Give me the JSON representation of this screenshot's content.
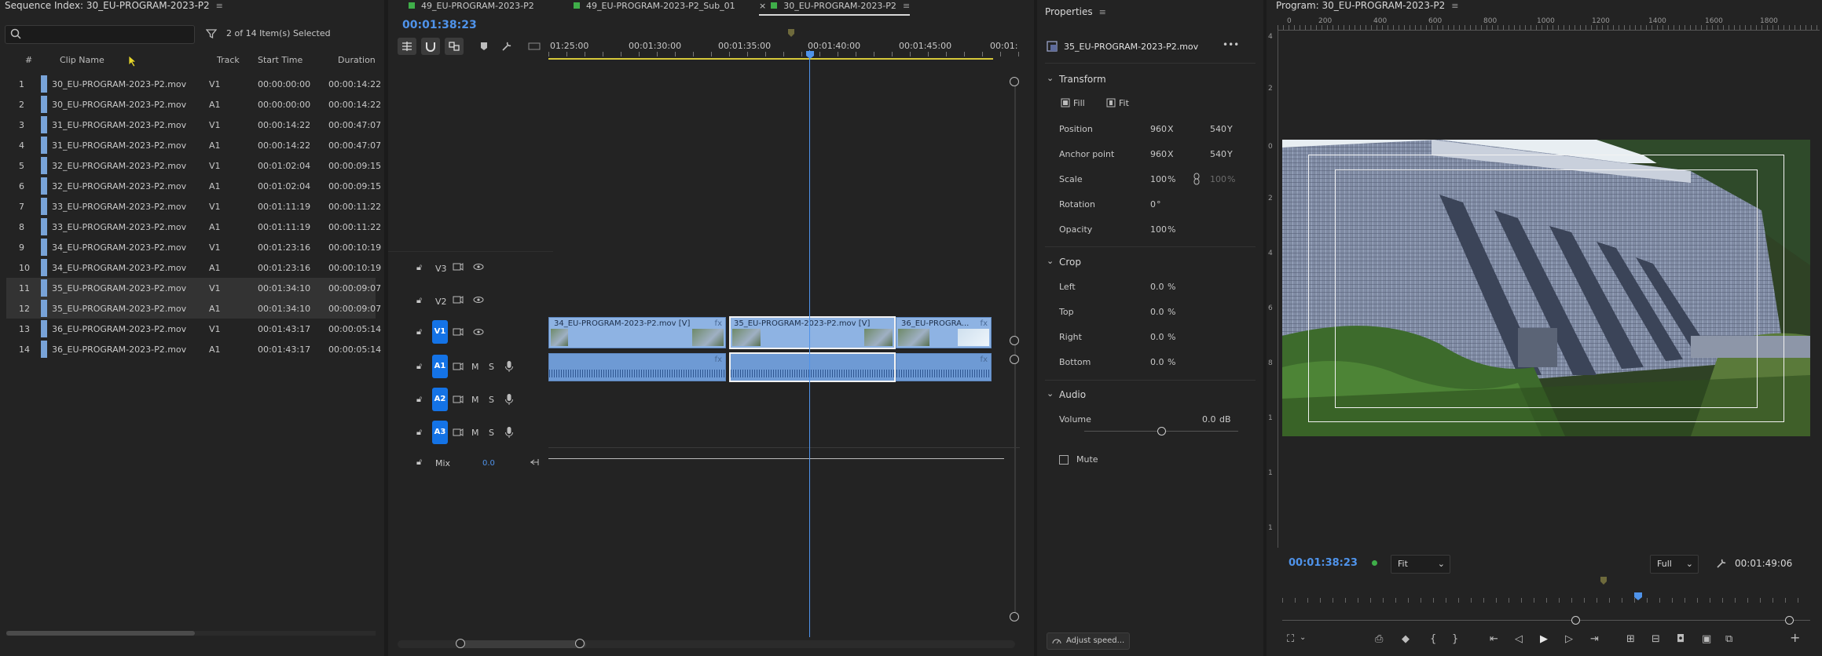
{
  "sequence_index": {
    "title": "Sequence Index: 30_EU-PROGRAM-2023-P2",
    "search_placeholder": "",
    "selection_status": "2 of 14 Item(s) Selected",
    "columns": [
      "#",
      "Clip Name",
      "Track",
      "Start Time",
      "Duration"
    ],
    "rows": [
      {
        "num": "1",
        "name": "30_EU-PROGRAM-2023-P2.mov",
        "track": "V1",
        "start": "00:00:00:00",
        "duration": "00:00:14:22"
      },
      {
        "num": "2",
        "name": "30_EU-PROGRAM-2023-P2.mov",
        "track": "A1",
        "start": "00:00:00:00",
        "duration": "00:00:14:22"
      },
      {
        "num": "3",
        "name": "31_EU-PROGRAM-2023-P2.mov",
        "track": "V1",
        "start": "00:00:14:22",
        "duration": "00:00:47:07"
      },
      {
        "num": "4",
        "name": "31_EU-PROGRAM-2023-P2.mov",
        "track": "A1",
        "start": "00:00:14:22",
        "duration": "00:00:47:07"
      },
      {
        "num": "5",
        "name": "32_EU-PROGRAM-2023-P2.mov",
        "track": "V1",
        "start": "00:01:02:04",
        "duration": "00:00:09:15"
      },
      {
        "num": "6",
        "name": "32_EU-PROGRAM-2023-P2.mov",
        "track": "A1",
        "start": "00:01:02:04",
        "duration": "00:00:09:15"
      },
      {
        "num": "7",
        "name": "33_EU-PROGRAM-2023-P2.mov",
        "track": "V1",
        "start": "00:01:11:19",
        "duration": "00:00:11:22"
      },
      {
        "num": "8",
        "name": "33_EU-PROGRAM-2023-P2.mov",
        "track": "A1",
        "start": "00:01:11:19",
        "duration": "00:00:11:22"
      },
      {
        "num": "9",
        "name": "34_EU-PROGRAM-2023-P2.mov",
        "track": "V1",
        "start": "00:01:23:16",
        "duration": "00:00:10:19"
      },
      {
        "num": "10",
        "name": "34_EU-PROGRAM-2023-P2.mov",
        "track": "A1",
        "start": "00:01:23:16",
        "duration": "00:00:10:19"
      },
      {
        "num": "11",
        "name": "35_EU-PROGRAM-2023-P2.mov",
        "track": "V1",
        "start": "00:01:34:10",
        "duration": "00:00:09:07"
      },
      {
        "num": "12",
        "name": "35_EU-PROGRAM-2023-P2.mov",
        "track": "A1",
        "start": "00:01:34:10",
        "duration": "00:00:09:07"
      },
      {
        "num": "13",
        "name": "36_EU-PROGRAM-2023-P2.mov",
        "track": "V1",
        "start": "00:01:43:17",
        "duration": "00:00:05:14"
      },
      {
        "num": "14",
        "name": "36_EU-PROGRAM-2023-P2.mov",
        "track": "A1",
        "start": "00:01:43:17",
        "duration": "00:00:05:14"
      }
    ]
  },
  "timeline": {
    "tabs": [
      "49_EU-PROGRAM-2023-P2",
      "49_EU-PROGRAM-2023-P2_Sub_01",
      "30_EU-PROGRAM-2023-P2"
    ],
    "close_glyph": "×",
    "menu_glyph": "≡",
    "timecode": "00:01:38:23",
    "ruler": [
      "01:25:00",
      "00:01:30:00",
      "00:01:35:00",
      "00:01:40:00",
      "00:01:45:00",
      "00:01:"
    ],
    "tracks": {
      "v3": "V3",
      "v2": "V2",
      "v1": "V1",
      "a1": "A1",
      "a2": "A2",
      "a3": "A3",
      "mix": "Mix",
      "mix_value": "0.0",
      "m": "M",
      "s": "S"
    },
    "clips": {
      "clip34": "34_EU-PROGRAM-2023-P2.mov [V]",
      "clip35": "35_EU-PROGRAM-2023-P2.mov [V]",
      "clip36": "36_EU-PROGRA...",
      "fx": "fx"
    }
  },
  "properties": {
    "title": "Properties",
    "clip_name": "35_EU-PROGRAM-2023-P2.mov",
    "more": "•••",
    "transform": "Transform",
    "fill": "Fill",
    "fit": "Fit",
    "position_label": "Position",
    "position_x": "960",
    "position_y": "540",
    "anchor_label": "Anchor point",
    "anchor_x": "960",
    "anchor_y": "540",
    "x_unit": "X",
    "y_unit": "Y",
    "scale_label": "Scale",
    "scale": "100",
    "scale_h": "100",
    "pct": "%",
    "rotation_label": "Rotation",
    "rotation": "0",
    "deg": "°",
    "opacity_label": "Opacity",
    "opacity": "100",
    "crop": "Crop",
    "crop_left_label": "Left",
    "crop_left": "0.0",
    "crop_top_label": "Top",
    "crop_top": "0.0",
    "crop_right_label": "Right",
    "crop_right": "0.0",
    "crop_bottom_label": "Bottom",
    "crop_bottom": "0.0",
    "audio": "Audio",
    "volume_label": "Volume",
    "volume": "0.0",
    "db": "dB",
    "volume_level": 0.5,
    "mute": "Mute",
    "adjust_speed": "Adjust speed..."
  },
  "program": {
    "title": "Program: 30_EU-PROGRAM-2023-P2",
    "ruler_h": [
      "0",
      "200",
      "400",
      "600",
      "800",
      "1000",
      "1200",
      "1400",
      "1600",
      "1800"
    ],
    "ruler_v": [
      "4",
      "2",
      "0",
      "2",
      "4",
      "6",
      "8",
      "1",
      "1",
      "1"
    ],
    "timecode": "00:01:38:23",
    "fit": "Fit",
    "quality": "Full",
    "duration": "00:01:49:06"
  },
  "colors": {
    "accent_blue": "#4f93ea",
    "track_blue": "#1473e6",
    "clip_video": "#8eb3e3",
    "clip_audio": "#6e9ad4",
    "playhead_yellow": "#d6c83a",
    "label_green": "#3fae49"
  }
}
